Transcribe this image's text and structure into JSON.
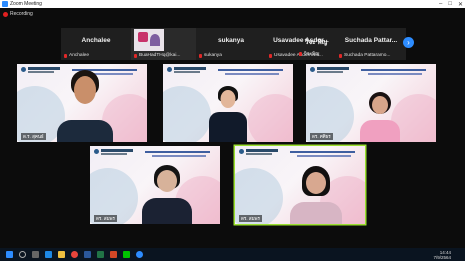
{
  "window": {
    "title": "Zoom Meeting"
  },
  "recording": {
    "label": "Recording"
  },
  "participants_strip": [
    {
      "name": "Anchalee",
      "sub": "Anchalee"
    },
    {
      "name": "",
      "sub": "BuaHadTHq@kai..."
    },
    {
      "name": "sukanya",
      "sub": "sukanya"
    },
    {
      "name": "Usavadee Asdor...",
      "sub": "Usavadee Asdornwis..."
    },
    {
      "name": "วิจะ พิญ",
      "sub": "วิจะพิญ"
    },
    {
      "name": "Suchada Pattar...",
      "sub": "Suchada Pattaramo..."
    }
  ],
  "tiles": [
    {
      "name": "ด.ร. สุคนธ์",
      "active": false
    },
    {
      "name": "",
      "active": false
    },
    {
      "name": "ดร. ศศิธร",
      "active": false
    },
    {
      "name": "ดร. สมพร",
      "active": false
    },
    {
      "name": "ดร. สมพร",
      "active": true
    }
  ],
  "clock": {
    "time": "14:44",
    "date": "7/9/2564"
  },
  "icons": [
    "windows-icon",
    "search-icon",
    "task-view-icon",
    "edge-icon",
    "folder-icon",
    "chrome-icon",
    "word-icon",
    "excel-icon",
    "powerpoint-icon",
    "line-icon",
    "zoom-icon"
  ],
  "colors": {
    "accent": "#2d8cff",
    "active_border": "#9be030",
    "rec": "#e02020"
  }
}
